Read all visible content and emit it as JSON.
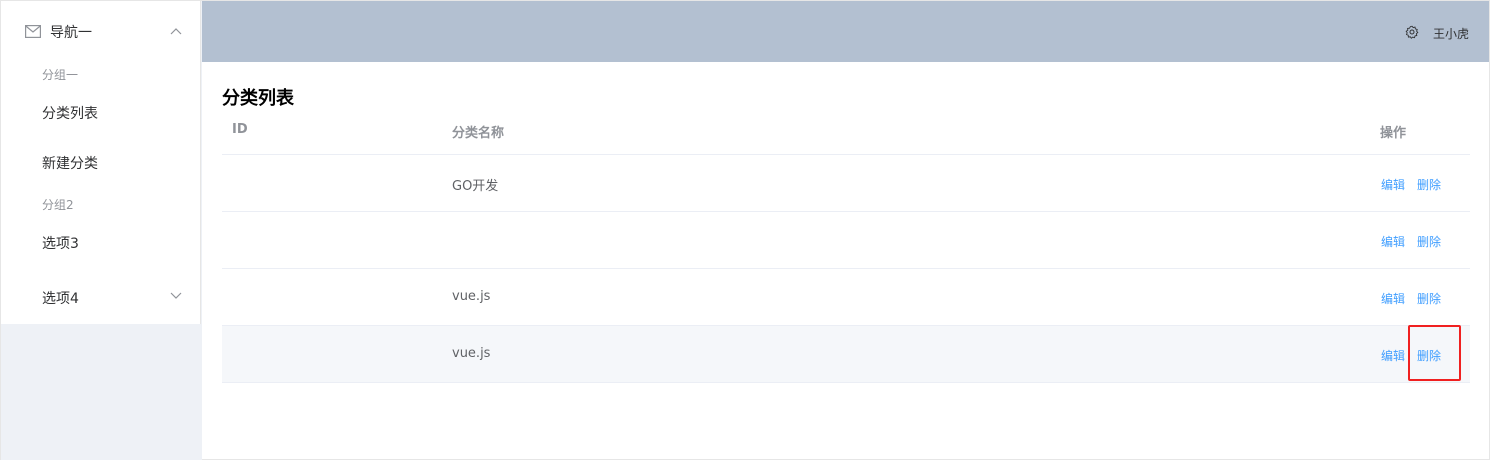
{
  "sidebar": {
    "nav1": {
      "label": "导航一",
      "icon": "mail-icon",
      "expanded": true
    },
    "group1_title": "分组一",
    "items": [
      {
        "label": "分类列表"
      },
      {
        "label": "新建分类"
      }
    ],
    "group2_title": "分组2",
    "option3": "选项3",
    "option4": {
      "label": "选项4",
      "expanded": false
    }
  },
  "header": {
    "settings_icon": "gear-icon",
    "user_name": "王小虎",
    "background": "#b3c0d1"
  },
  "main": {
    "title": "分类列表",
    "table": {
      "columns": {
        "id": "ID",
        "name": "分类名称",
        "actions": "操作"
      },
      "rows": [
        {
          "id": "",
          "name": "GO开发"
        },
        {
          "id": "",
          "name": ""
        },
        {
          "id": "",
          "name": "vue.js"
        },
        {
          "id": "",
          "name": "vue.js"
        }
      ],
      "edit_label": "编辑",
      "delete_label": "删除"
    }
  },
  "colors": {
    "accent": "#409eff",
    "highlight": "#f02020"
  }
}
